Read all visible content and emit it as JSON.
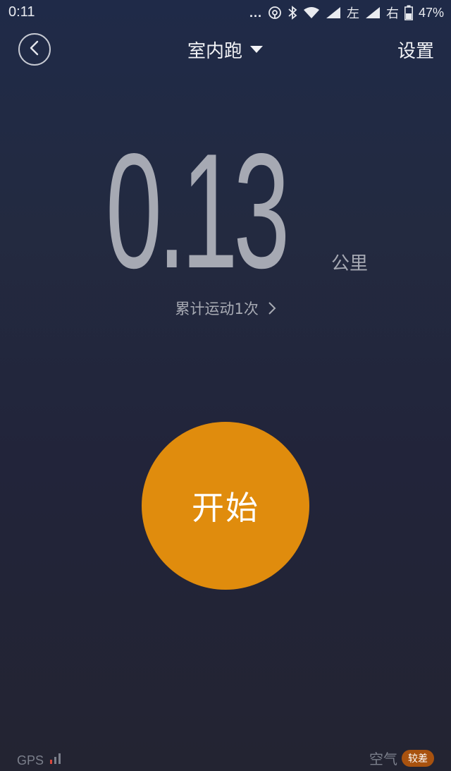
{
  "status_bar": {
    "time": "0:11",
    "dots": "...",
    "sim1_label": "左",
    "sim2_label": "右",
    "battery": "47%"
  },
  "header": {
    "mode": "室内跑",
    "settings": "设置"
  },
  "distance": {
    "value": "0.13",
    "unit": "公里"
  },
  "stats": {
    "label": "累计运动1次"
  },
  "start_button": {
    "label": "开始"
  },
  "footer": {
    "gps_label": "GPS",
    "air_label": "空气",
    "air_quality": "较差"
  },
  "colors": {
    "accent": "#e08c0d",
    "air_badge": "#a8520f",
    "gps_signal": "#d9473d"
  }
}
